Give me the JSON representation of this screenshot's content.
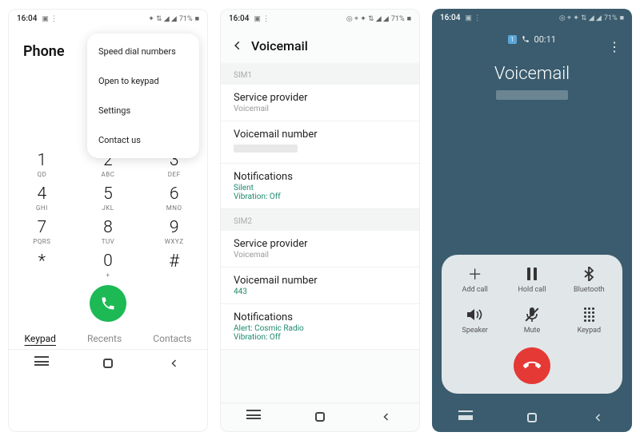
{
  "status": {
    "time": "16:04",
    "battery": "71%"
  },
  "screen1": {
    "title": "Phone",
    "menu": [
      "Speed dial numbers",
      "Open to keypad",
      "Settings",
      "Contact us"
    ],
    "keys": [
      {
        "n": "1",
        "s": "QD"
      },
      {
        "n": "2",
        "s": "ABC"
      },
      {
        "n": "3",
        "s": "DEF"
      },
      {
        "n": "4",
        "s": "GHI"
      },
      {
        "n": "5",
        "s": "JKL"
      },
      {
        "n": "6",
        "s": "MNO"
      },
      {
        "n": "7",
        "s": "PQRS"
      },
      {
        "n": "8",
        "s": "TUV"
      },
      {
        "n": "9",
        "s": "WXYZ"
      },
      {
        "n": "*",
        "s": ""
      },
      {
        "n": "0",
        "s": "+"
      },
      {
        "n": "#",
        "s": ""
      }
    ],
    "tabs": {
      "keypad": "Keypad",
      "recents": "Recents",
      "contacts": "Contacts"
    }
  },
  "screen2": {
    "title": "Voicemail",
    "sections": [
      {
        "label": "SIM1",
        "rows": [
          {
            "title": "Service provider",
            "sub": "Voicemail",
            "green": false
          },
          {
            "title": "Voicemail number",
            "redacted": true
          },
          {
            "title": "Notifications",
            "sub": "Silent",
            "sub2": "Vibration: Off",
            "green": true
          }
        ]
      },
      {
        "label": "SIM2",
        "rows": [
          {
            "title": "Service provider",
            "sub": "Voicemail",
            "green": false
          },
          {
            "title": "Voicemail number",
            "sub": "443",
            "green": true
          },
          {
            "title": "Notifications",
            "sub": "Alert: Cosmic Radio",
            "sub2": "Vibration: Off",
            "green": true
          }
        ]
      }
    ]
  },
  "screen3": {
    "sim": "1",
    "timer": "00:11",
    "title": "Voicemail",
    "actions": [
      {
        "id": "add-call",
        "label": "Add call"
      },
      {
        "id": "hold-call",
        "label": "Hold call"
      },
      {
        "id": "bluetooth",
        "label": "Bluetooth"
      },
      {
        "id": "speaker",
        "label": "Speaker"
      },
      {
        "id": "mute",
        "label": "Mute"
      },
      {
        "id": "keypad",
        "label": "Keypad"
      }
    ]
  }
}
